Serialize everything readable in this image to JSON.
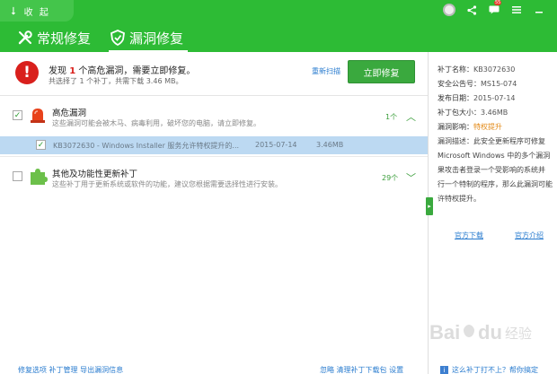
{
  "header": {
    "collapse_label": "收 起",
    "tabs": [
      {
        "label": "常规修复",
        "active": false
      },
      {
        "label": "漏洞修复",
        "active": true
      }
    ],
    "message_count": "55"
  },
  "summary": {
    "title_pre": "发现 ",
    "title_num": "1",
    "title_post": " 个高危漏洞，需要立即修复。",
    "subtitle": "共选择了 1 个补丁，共需下载 3.46 MB。",
    "rescan_label": "重新扫描",
    "fix_button_label": "立即修复"
  },
  "categories": [
    {
      "title": "高危漏洞",
      "desc": "这些漏洞可能会被木马、病毒利用，破坏您的电脑，请立即修复。",
      "count": "1个",
      "checked": true,
      "expanded": true
    },
    {
      "title": "其他及功能性更新补丁",
      "desc": "这些补丁用于更新系统或软件的功能，建议您根据需要选择性进行安装。",
      "count": "29个",
      "checked": false,
      "expanded": false
    }
  ],
  "patch": {
    "name": "KB3072630 - Windows Installer 服务允许特权提升的...",
    "date": "2015-07-14",
    "size": "3.46MB",
    "checked": true
  },
  "detail": {
    "rows": [
      {
        "key": "补丁名称：",
        "value": "KB3072630"
      },
      {
        "key": "安全公告号：",
        "value": "MS15-074"
      },
      {
        "key": "发布日期：",
        "value": "2015-07-14"
      },
      {
        "key": "补丁包大小：",
        "value": "3.46MB"
      },
      {
        "key": "漏洞影响：",
        "value": "特权提升"
      }
    ],
    "desc_key": "漏洞描述：",
    "desc_lines": [
      "此安全更新程序可修复",
      "Microsoft Windows 中的多个漏洞",
      "果攻击者登录一个受影响的系统并",
      "行一个特制的程序，那么此漏洞可能",
      "许特权提升。"
    ],
    "link_download": "官方下载",
    "link_intro": "官方介绍"
  },
  "footer": {
    "left": "修复选项  补丁管理  导出漏洞信息",
    "mid": "忽略  清理补丁下载包  设置",
    "right": "这么补丁打不上？帮你搞定"
  },
  "colors": {
    "header_green": "#2dbb35",
    "button_green": "#3aa93e",
    "danger_red": "#d9201c",
    "link_blue": "#2a7ccf",
    "selected_row": "#bcd9f2"
  }
}
